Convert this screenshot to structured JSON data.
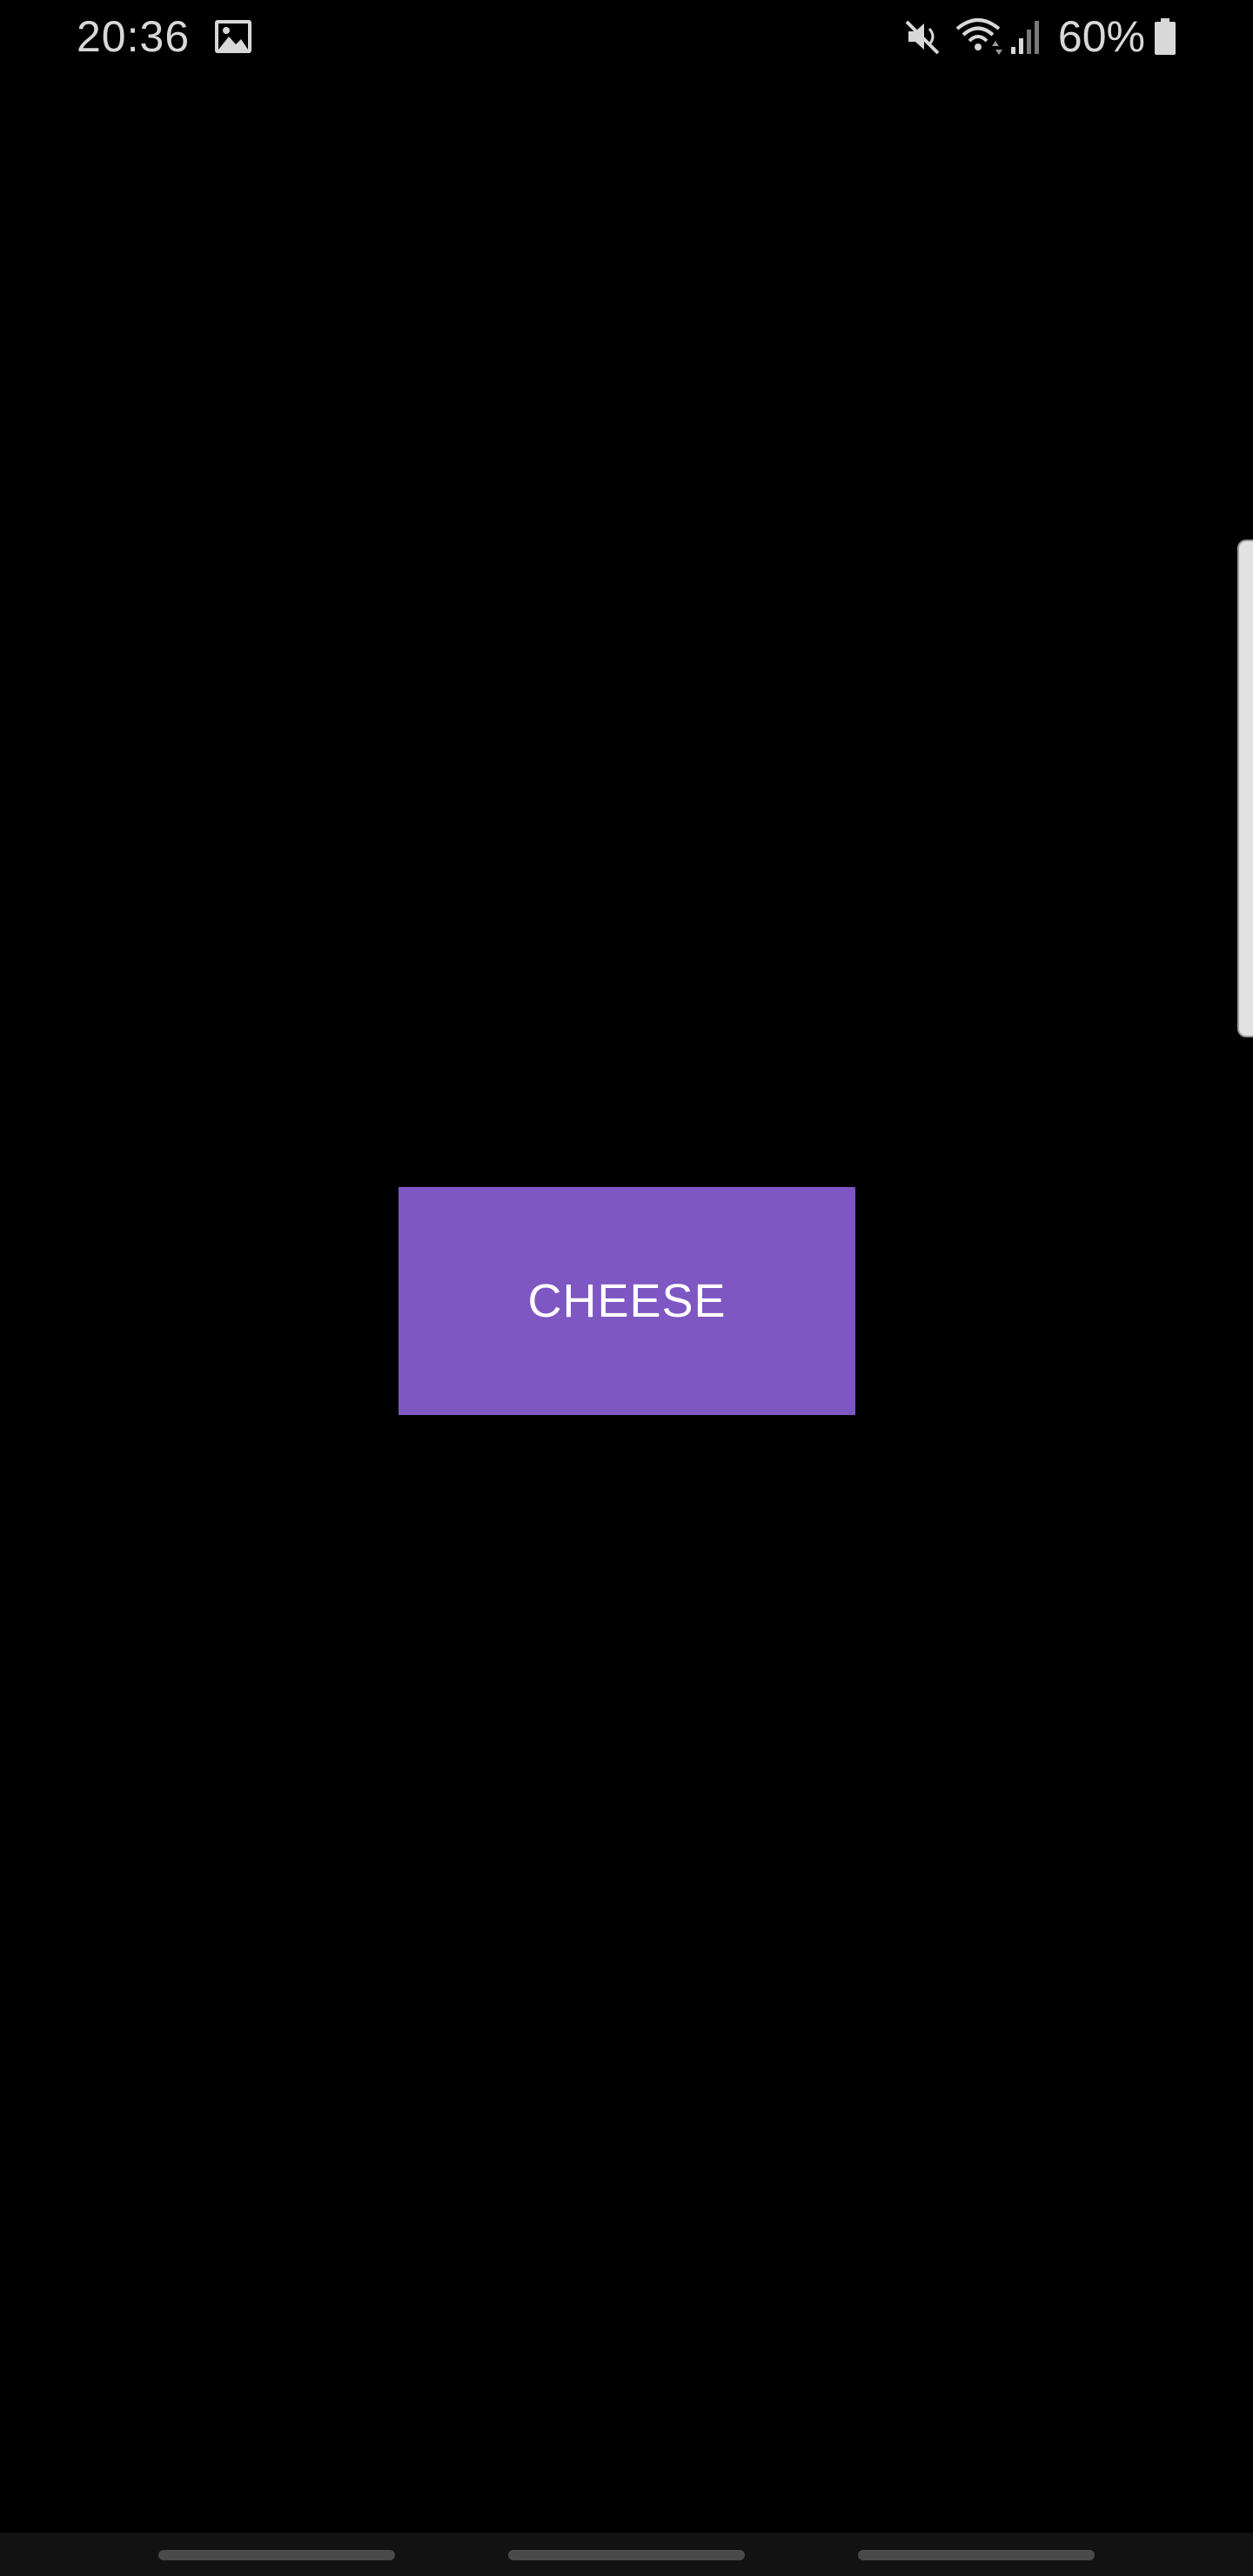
{
  "status_bar": {
    "time": "20:36",
    "battery_percent": "60%",
    "icons": [
      "gallery-icon",
      "mute-icon",
      "wifi-icon",
      "signal-icon",
      "battery-icon"
    ]
  },
  "main": {
    "button_label": "CHEESE",
    "button_color": "#7e57c2",
    "background_color": "#000000"
  },
  "nav_bar": {
    "buttons": [
      "recent-apps",
      "home",
      "back"
    ]
  }
}
